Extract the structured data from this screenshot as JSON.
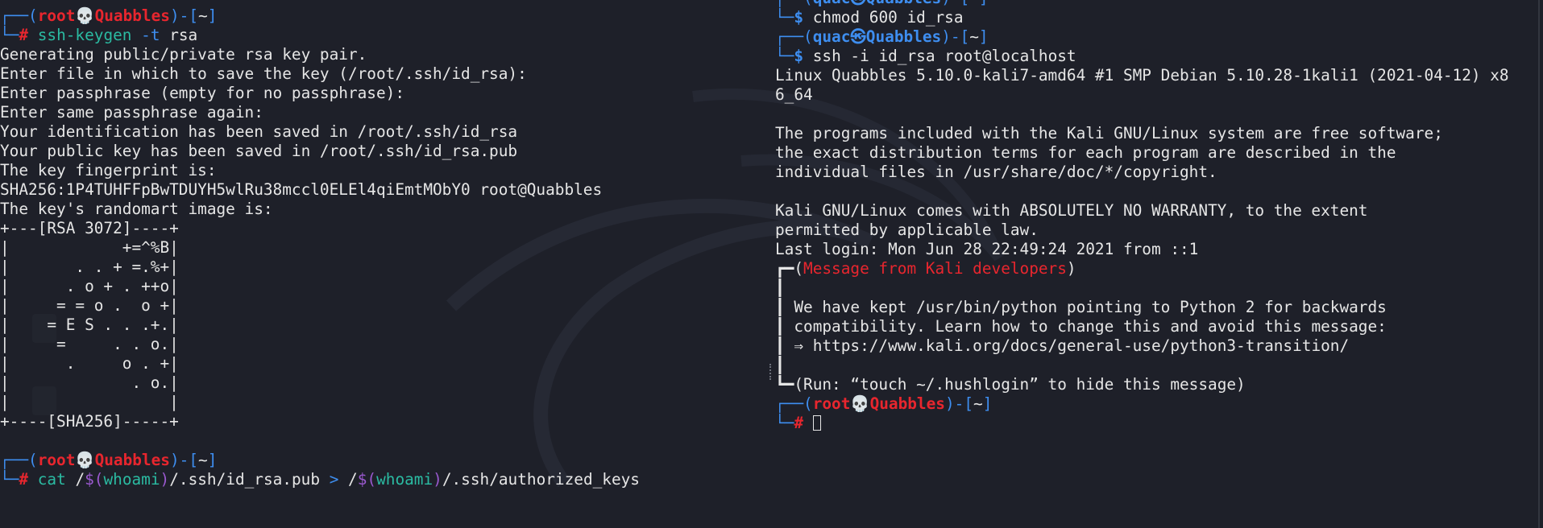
{
  "prompt": {
    "root_user": "root",
    "skull": "💀",
    "host": "Quabbles",
    "dir": "~",
    "quac_user": "quac",
    "user_sep": "㉿",
    "root_symbol": "#",
    "user_symbol": "$"
  },
  "left": {
    "cmd1_name": "ssh-keygen",
    "cmd1_flag": " -t",
    "cmd1_arg": " rsa",
    "output": [
      "Generating public/private rsa key pair.",
      "Enter file in which to save the key (/root/.ssh/id_rsa):",
      "Enter passphrase (empty for no passphrase):",
      "Enter same passphrase again:",
      "Your identification has been saved in /root/.ssh/id_rsa",
      "Your public key has been saved in /root/.ssh/id_rsa.pub",
      "The key fingerprint is:",
      "SHA256:1P4TUHFFpBwTDUYH5wlRu38mccl0ELEl4qiEmtMObY0 root@Quabbles",
      "The key's randomart image is:",
      "+---[RSA 3072]----+",
      "|            +=^%B|",
      "|       . . + =.%+|",
      "|      . o + . ++o|",
      "|     = = o .  o +|",
      "|    = E S . . .+.|",
      "|     =     . . o.|",
      "|      .     o . +|",
      "|             . o.|",
      "|                 |",
      "+----[SHA256]-----+",
      ""
    ],
    "cmd2": {
      "p1": "cat",
      "p2": " /",
      "p3": "$(",
      "p4": "whoami",
      "p5": ")",
      "p6": "/.ssh/id_rsa.pub",
      "p7": " > ",
      "p8": "/",
      "p9": "$(",
      "p10": "whoami",
      "p11": ")",
      "p12": "/.ssh/authorized_keys"
    }
  },
  "right": {
    "cmd1": "chmod 600 id_rsa",
    "cmd2": "ssh -i id_rsa root@localhost",
    "output": [
      "Linux Quabbles 5.10.0-kali7-amd64 #1 SMP Debian 5.10.28-1kali1 (2021-04-12) x8",
      "6_64",
      "",
      "The programs included with the Kali GNU/Linux system are free software;",
      "the exact distribution terms for each program are described in the",
      "individual files in /usr/share/doc/*/copyright.",
      "",
      "Kali GNU/Linux comes with ABSOLUTELY NO WARRANTY, to the extent",
      "permitted by applicable law.",
      "Last login: Mon Jun 28 22:49:24 2021 from ::1"
    ],
    "msg_title": "Message from Kali developers",
    "msg_lines": [
      "",
      "We have kept /usr/bin/python pointing to Python 2 for backwards",
      "compatibility. Learn how to change this and avoid this message:",
      "⇒ https://www.kali.org/docs/general-use/python3-transition/",
      ""
    ],
    "msg_footer": "(Run: “touch ~/.hushlogin” to hide this message)"
  },
  "colors": {
    "background": "#1e2029",
    "prompt_frame": "#3e8ef0",
    "root_red": "#e8262e",
    "command_green": "#2bbba2",
    "subst_purple": "#9b59d0"
  }
}
